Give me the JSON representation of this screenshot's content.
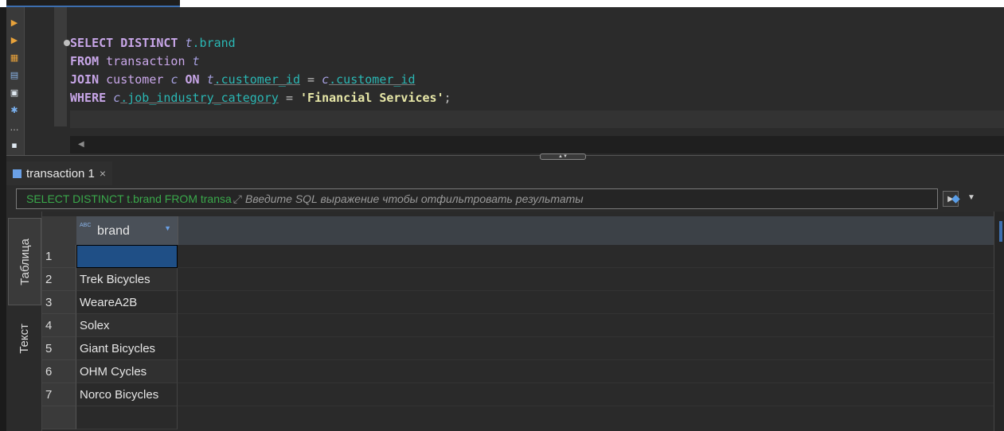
{
  "editor": {
    "sql_lines": [
      [
        "SELECT",
        "DISTINCT",
        "t",
        ".brand"
      ],
      [
        "FROM",
        "transaction",
        "t"
      ],
      [
        "JOIN",
        "customer",
        "c",
        "ON",
        "t",
        ".customer_id",
        "=",
        "c",
        ".customer_id"
      ],
      [
        "WHERE",
        "c",
        ".job_industry_category",
        "=",
        "'Financial Services'",
        ";"
      ]
    ]
  },
  "results": {
    "tab_label": "transaction 1",
    "close_symbol": "×",
    "filter": {
      "sql_preview": "SELECT DISTINCT t.brand FROM transa",
      "placeholder": "Введите SQL выражение чтобы отфильтровать результаты"
    },
    "side_tabs": {
      "table": "Таблица",
      "text": "Текст"
    },
    "columns": [
      "brand"
    ],
    "rows": [
      {
        "num": "1",
        "brand": ""
      },
      {
        "num": "2",
        "brand": "Trek Bicycles"
      },
      {
        "num": "3",
        "brand": "WeareA2B"
      },
      {
        "num": "4",
        "brand": "Solex"
      },
      {
        "num": "5",
        "brand": "Giant Bicycles"
      },
      {
        "num": "6",
        "brand": "OHM Cycles"
      },
      {
        "num": "7",
        "brand": "Norco Bicycles"
      }
    ]
  },
  "colors": {
    "accent": "#3d6fb0",
    "keyword": "#c8a6e8",
    "column": "#2ab7b4",
    "string": "#e8e8a8",
    "filter_sql": "#3aa94b"
  }
}
